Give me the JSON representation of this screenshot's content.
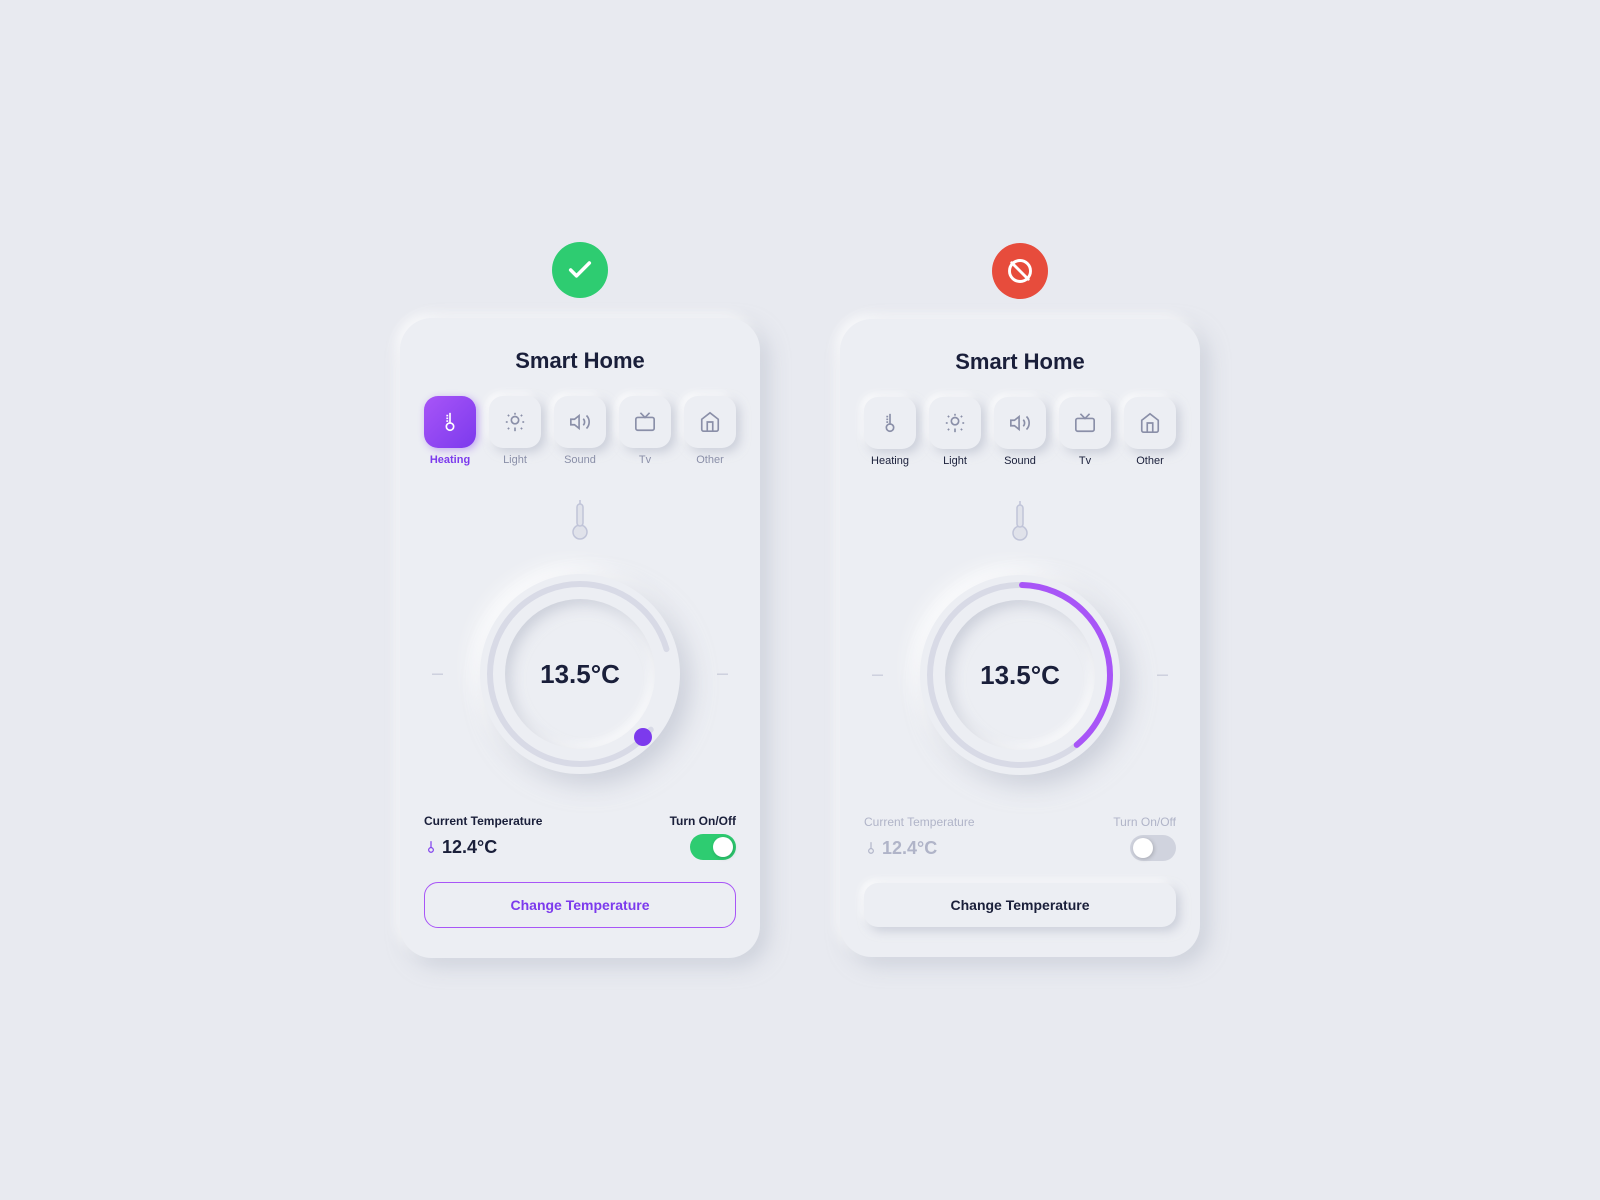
{
  "page": {
    "background": "#e8eaf0"
  },
  "left_card": {
    "badge": "check",
    "badge_color": "green",
    "title": "Smart Home",
    "categories": [
      {
        "id": "heating",
        "label": "Heating",
        "active": true
      },
      {
        "id": "light",
        "label": "Light",
        "active": false
      },
      {
        "id": "sound",
        "label": "Sound",
        "active": false
      },
      {
        "id": "tv",
        "label": "Tv",
        "active": false
      },
      {
        "id": "other",
        "label": "Other",
        "active": false
      }
    ],
    "dial_temp": "13.5°C",
    "current_temp_label": "Current Temperature",
    "current_temp_value": "12.4°C",
    "turn_on_off_label": "Turn On/Off",
    "toggle_state": "on",
    "change_temp_btn": "Change Temperature"
  },
  "right_card": {
    "badge": "ban",
    "badge_color": "red",
    "title": "Smart Home",
    "categories": [
      {
        "id": "heating",
        "label": "Heating",
        "active": false
      },
      {
        "id": "light",
        "label": "Light",
        "active": false
      },
      {
        "id": "sound",
        "label": "Sound",
        "active": false
      },
      {
        "id": "tv",
        "label": "Tv",
        "active": false
      },
      {
        "id": "other",
        "label": "Other",
        "active": false
      }
    ],
    "dial_temp": "13.5°C",
    "current_temp_label": "Current Temperature",
    "current_temp_value": "12.4°C",
    "turn_on_off_label": "Turn On/Off",
    "toggle_state": "off",
    "change_temp_btn": "Change Temperature"
  }
}
